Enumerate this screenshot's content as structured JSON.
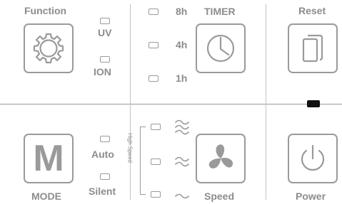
{
  "function": {
    "label": "Function",
    "icon": "gear-icon"
  },
  "uv": {
    "label": "UV"
  },
  "ion": {
    "label": "ION"
  },
  "timer": {
    "label": "TIMER",
    "icon": "clock-icon",
    "options": [
      {
        "label": "8h"
      },
      {
        "label": "4h"
      },
      {
        "label": "1h"
      }
    ]
  },
  "reset": {
    "label": "Reset",
    "icon": "filter-icon"
  },
  "mode": {
    "label": "MODE",
    "button_text": "M"
  },
  "auto": {
    "label": "Auto"
  },
  "silent": {
    "label": "Silent"
  },
  "speed": {
    "label": "Speed",
    "icon": "fan-icon",
    "bracket_label": "High Speed",
    "levels": [
      "high",
      "medium",
      "low"
    ]
  },
  "power": {
    "label": "Power",
    "icon": "power-icon"
  },
  "colors": {
    "outline": "#9a9a9a",
    "text": "#8c8c8c",
    "indicator": "#111111"
  }
}
